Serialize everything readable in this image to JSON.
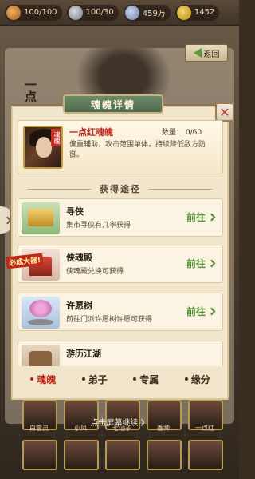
{
  "resources": [
    {
      "icon": "energy-icon",
      "value": "100/100"
    },
    {
      "icon": "silver-icon",
      "value": "100/30"
    },
    {
      "icon": "coin-icon",
      "value": "459万"
    },
    {
      "icon": "gold-icon",
      "value": "1452"
    }
  ],
  "back_label": "返回",
  "background_side_text": "一点",
  "modal": {
    "title": "魂魄详情",
    "item": {
      "tag": "魂魄",
      "name": "一点红魂魄",
      "qty_label": "数量：",
      "qty_value": "0/60",
      "desc": "偏重辅助，攻击范围单体，持续降低敌方防御。"
    },
    "section_title": "获得途径",
    "ways": [
      {
        "icon": "search-icon",
        "title": "寻侠",
        "sub": "集市寻侠有几率获得",
        "go": "前往"
      },
      {
        "icon": "hall-icon",
        "title": "侠魂殿",
        "sub": "侠魂殿兑换可获得",
        "go": "前往"
      },
      {
        "icon": "tree-icon",
        "title": "许愿树",
        "sub": "前往门派许愿树许愿可获得",
        "go": "前往"
      },
      {
        "icon": "travel-icon",
        "title": "游历江湖",
        "sub": "",
        "go": ""
      }
    ],
    "badge": "必成大器!",
    "tabs": [
      "魂魄",
      "弟子",
      "专属",
      "缘分"
    ]
  },
  "continue_text": "点击屏幕继续 》",
  "strip_names": [
    "白雪灵",
    "小凤",
    "七仙子",
    "香帅",
    "一点红"
  ]
}
